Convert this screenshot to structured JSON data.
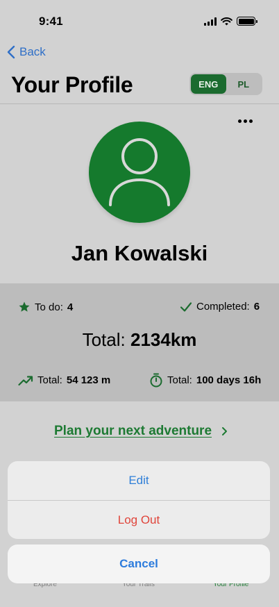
{
  "status_bar": {
    "time": "9:41"
  },
  "nav": {
    "back_label": "Back",
    "title": "Your Profile"
  },
  "language": {
    "options": [
      "ENG",
      "PL"
    ],
    "selected": "ENG"
  },
  "profile": {
    "name": "Jan Kowalski"
  },
  "stats": {
    "todo_label": "To do:",
    "todo_value": "4",
    "completed_label": "Completed:",
    "completed_value": "6",
    "total_label": "Total:",
    "total_value": "2134km",
    "elevation_label": "Total:",
    "elevation_value": "54 123 m",
    "time_label": "Total:",
    "time_value": "100 days 16h"
  },
  "plan_link": "Plan your next adventure",
  "tabbar": {
    "items": [
      "Explore",
      "Your Trails",
      "Your Profile"
    ],
    "active": "Your Profile"
  },
  "action_sheet": {
    "edit": "Edit",
    "logout": "Log Out",
    "cancel": "Cancel"
  },
  "colors": {
    "accent_green": "#1b6b2f",
    "link_blue": "#2f6fc7",
    "destructive_red": "#e0443a"
  },
  "icons": [
    "chevron-left-icon",
    "ellipsis-icon",
    "person-icon",
    "star-icon",
    "checkmark-icon",
    "trend-up-icon",
    "stopwatch-icon",
    "chevron-right-icon"
  ]
}
